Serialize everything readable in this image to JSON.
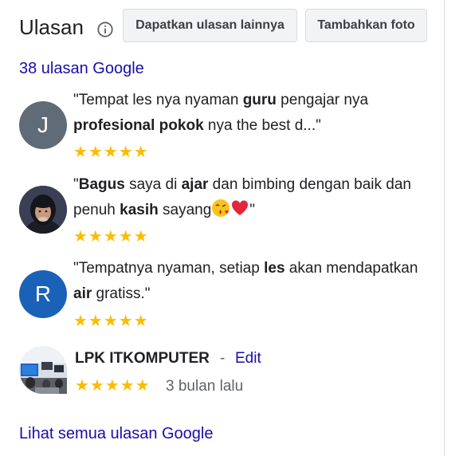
{
  "header": {
    "title": "Ulasan",
    "info_icon": "info-icon",
    "more_reviews_button": "Dapatkan ulasan lainnya",
    "add_photo_button": "Tambahkan foto"
  },
  "review_count_link": "38 ulasan Google",
  "reviews": [
    {
      "avatar_letter": "J",
      "avatar_color": "#5f6b76",
      "text_parts": [
        "\"Tempat les nya nyaman ",
        "guru",
        " pengajar nya ",
        "profesional pokok",
        " nya the best d...\""
      ],
      "rating": 5,
      "stars": "★★★★★"
    },
    {
      "avatar_letter": "",
      "avatar_color": "#2b2b33",
      "avatar_image": "profile-photo",
      "text_parts": [
        "\"",
        "Bagus",
        " saya di ",
        "ajar",
        " dan bimbing dengan baik dan penuh ",
        "kasih",
        " sayang"
      ],
      "text_end": "\"",
      "emojis": [
        "kiss-emoji",
        "red-heart-emoji"
      ],
      "rating": 5,
      "stars": "★★★★★"
    },
    {
      "avatar_letter": "R",
      "avatar_color": "#1a62b8",
      "text_parts": [
        "\"Tempatnya nyaman, setiap ",
        "les",
        " akan mendapatkan ",
        "air",
        " gratiss.\""
      ],
      "rating": 5,
      "stars": "★★★★★"
    }
  ],
  "owner_review": {
    "name": "LPK ITKOMPUTER",
    "separator": "-",
    "edit": "Edit",
    "rating": 5,
    "stars": "★★★★★",
    "time": "3 bulan lalu",
    "avatar_image": "classroom-photo"
  },
  "see_all_link": "Lihat semua ulasan Google",
  "colors": {
    "link": "#1a0dab",
    "star": "#fbbc04",
    "button_bg": "#f1f3f4"
  }
}
